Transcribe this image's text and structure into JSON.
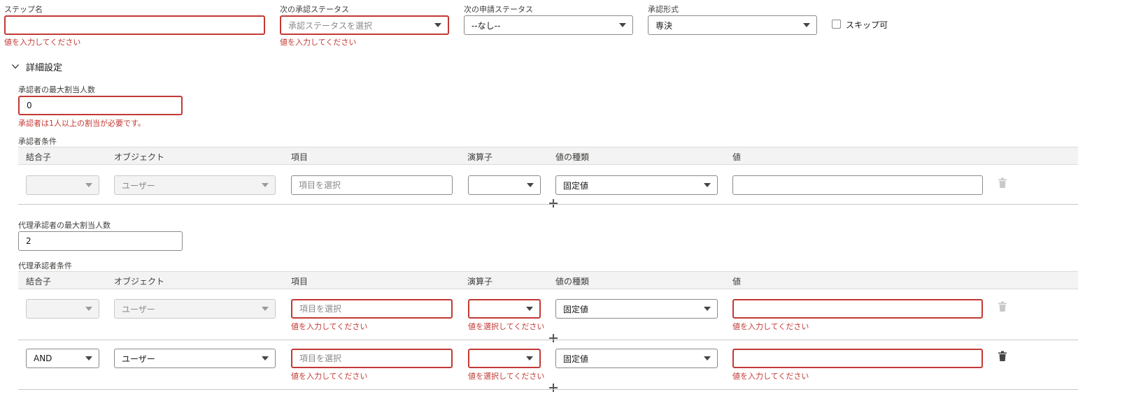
{
  "top": {
    "step_name_label": "ステップ名",
    "step_name_value": "",
    "step_name_error": "値を入力してください",
    "next_approval_status_label": "次の承認ステータス",
    "next_approval_status_placeholder": "承認ステータスを選択",
    "next_approval_status_error": "値を入力してください",
    "next_request_status_label": "次の申請ステータス",
    "next_request_status_value": "--なし--",
    "approval_type_label": "承認形式",
    "approval_type_value": "専決",
    "skip_label": "スキップ可",
    "skip_checked": false
  },
  "details": {
    "toggle_label": "詳細設定",
    "expanded": true
  },
  "approver": {
    "max_label": "承認者の最大割当人数",
    "max_value": "0",
    "max_error": "承認者は1人以上の割当が必要です。",
    "conditions_label": "承認者条件",
    "headers": {
      "conjunction": "結合子",
      "object": "オブジェクト",
      "field": "項目",
      "operator": "演算子",
      "value_type": "値の種類",
      "value": "値"
    },
    "rows": [
      {
        "conjunction": "",
        "object": "ユーザー",
        "field_placeholder": "項目を選択",
        "operator": "",
        "value_type": "固定値",
        "value": ""
      }
    ]
  },
  "delegate": {
    "max_label": "代理承認者の最大割当人数",
    "max_value": "2",
    "conditions_label": "代理承認者条件",
    "headers": {
      "conjunction": "結合子",
      "object": "オブジェクト",
      "field": "項目",
      "operator": "演算子",
      "value_type": "値の種類",
      "value": "値"
    },
    "rows": [
      {
        "conjunction": "",
        "object": "ユーザー",
        "field_placeholder": "項目を選択",
        "field_error": "値を入力してください",
        "operator": "",
        "operator_error": "値を選択してください",
        "value_type": "固定値",
        "value": "",
        "value_error": "値を入力してください"
      },
      {
        "conjunction": "AND",
        "object": "ユーザー",
        "field_placeholder": "項目を選択",
        "field_error": "値を入力してください",
        "operator": "",
        "operator_error": "値を選択してください",
        "value_type": "固定値",
        "value": "",
        "value_error": "値を入力してください"
      }
    ]
  },
  "colors": {
    "error": "#c23934",
    "header_bg": "#f3f3f3",
    "border": "#8a8a8a"
  },
  "icons": {
    "toggle": "chevron-down-icon",
    "delete": "trash-icon",
    "add": "plus-icon",
    "dropdown": "caret-down-icon"
  }
}
